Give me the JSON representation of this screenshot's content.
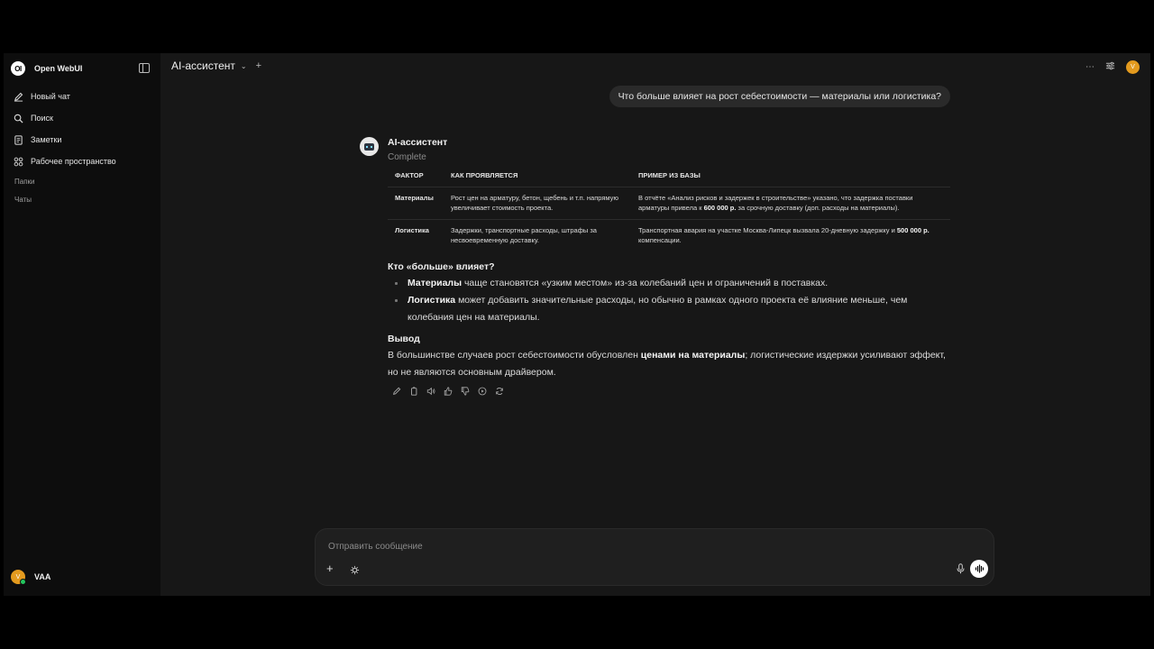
{
  "sidebar": {
    "brand": "Open WebUI",
    "logo_text": "OI",
    "items": [
      {
        "label": "Новый чат",
        "icon": "edit-icon"
      },
      {
        "label": "Поиск",
        "icon": "search-icon"
      },
      {
        "label": "Заметки",
        "icon": "notes-icon"
      },
      {
        "label": "Рабочее пространство",
        "icon": "workspace-icon"
      }
    ],
    "folders_label": "Папки",
    "chats_label": "Чаты",
    "user": {
      "initial": "V",
      "name": "VAA"
    }
  },
  "header": {
    "model_name": "AI-ассистент",
    "avatar_initial": "V"
  },
  "conversation": {
    "user_message": "Что больше влияет на рост себестоимости — материалы или логистика?",
    "assistant": {
      "name": "AI-ассистент",
      "status": "Complete",
      "table": {
        "headers": [
          "ФАКТОР",
          "КАК ПРОЯВЛЯЕТСЯ",
          "ПРИМЕР ИЗ БАЗЫ"
        ],
        "rows": [
          {
            "factor": "Материалы",
            "effect": "Рост цен на арматуру, бетон, щебень и т.п. напрямую увеличивает стоимость проекта.",
            "example_pre": "В отчёте «Анализ рисков и задержек в строительстве» указано, что задержка поставки арматуры привела к ",
            "example_bold": "600 000 р.",
            "example_post": " за срочную доставку (доп. расходы на материалы)."
          },
          {
            "factor": "Логистика",
            "effect": "Задержки, транспортные расходы, штрафы за несвоевременную доставку.",
            "example_pre": "Транспортная авария на участке Москва-Липецк вызвала 20-дневную задержку и ",
            "example_bold": "500 000 р.",
            "example_post": " компенсации."
          }
        ]
      },
      "section1_title": "Кто «больше» влияет?",
      "bullets": [
        {
          "bold": "Материалы",
          "text": " чаще становятся «узким местом» из-за колебаний цен и ограничений в поставках."
        },
        {
          "bold": "Логистика",
          "text": " может добавить значительные расходы, но обычно в рамках одного проекта её влияние меньше, чем колебания цен на материалы."
        }
      ],
      "section2_title": "Вывод",
      "conclusion_pre": "В большинстве случаев рост себестоимости обусловлен ",
      "conclusion_bold": "ценами на материалы",
      "conclusion_post": "; логистические издержки усиливают эффект, но не являются основным драйвером."
    }
  },
  "composer": {
    "placeholder": "Отправить сообщение"
  }
}
